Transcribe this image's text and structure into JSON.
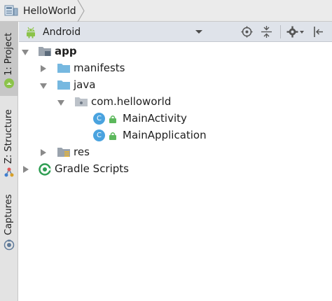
{
  "breadcrumb": {
    "project": "HelloWorld"
  },
  "tool_strip": {
    "tabs": [
      {
        "label": "1: Project"
      },
      {
        "label": "Z: Structure"
      },
      {
        "label": "Captures"
      }
    ]
  },
  "toolbar": {
    "view_selector": "Android"
  },
  "tree": {
    "items": [
      {
        "label": "app"
      },
      {
        "label": "manifests"
      },
      {
        "label": "java"
      },
      {
        "label": "com.helloworld"
      },
      {
        "label": "MainActivity",
        "badge": "C"
      },
      {
        "label": "MainApplication",
        "badge": "C"
      },
      {
        "label": "res"
      },
      {
        "label": "Gradle Scripts"
      }
    ]
  },
  "colors": {
    "folder": "#76b8e0",
    "class_badge": "#4aa3df",
    "android_green": "#8bc34a",
    "toolbar_bg": "#dfe3ea"
  }
}
